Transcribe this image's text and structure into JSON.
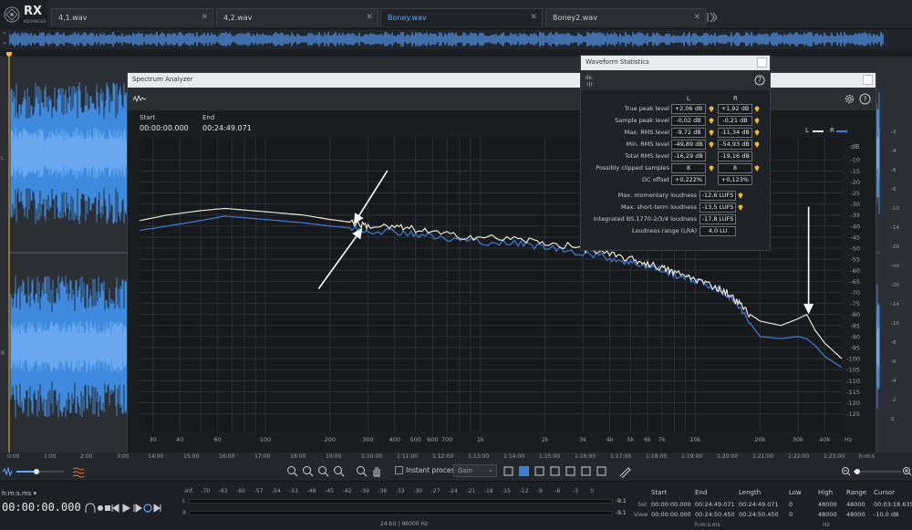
{
  "app": {
    "logo": "RX",
    "logo_sub": "ADVANCED"
  },
  "tabs": [
    {
      "label": "4,1.wav",
      "active": false
    },
    {
      "label": "4,2.wav",
      "active": false
    },
    {
      "label": "Boney.wav",
      "active": true
    },
    {
      "label": "Boney2.wav",
      "active": false
    }
  ],
  "spectrum": {
    "title": "Spectrum Analyzer",
    "start_label": "Start",
    "start_value": "00:00:00.000",
    "end_label": "End",
    "end_value": "00:24:49.071",
    "legend_L": "L",
    "legend_R": "R",
    "db_label": "dB"
  },
  "stats": {
    "title": "Waveform Statistics",
    "col_L": "L",
    "col_R": "R",
    "rows": [
      {
        "name": "True peak level",
        "L": "+2,06 dB",
        "R": "+1,92 dB"
      },
      {
        "name": "Sample peak level",
        "L": "-0,02 dB",
        "R": "-0,21 dB"
      },
      {
        "name": "Max. RMS level",
        "L": "-9,72 dB",
        "R": "-11,34 dB"
      },
      {
        "name": "Min. RMS level",
        "L": "-49,89 dB",
        "R": "-54,93 dB"
      },
      {
        "name": "Total RMS level",
        "L": "-16,29 dB",
        "R": "-19,16 dB"
      },
      {
        "name": "Possibly clipped samples",
        "L": "8",
        "R": "8"
      },
      {
        "name": "DC offset",
        "L": "+0,222%",
        "R": "+0,123%"
      }
    ],
    "loudness": [
      {
        "name": "Max. momentary loudness",
        "value": "-12,6 LUFS"
      },
      {
        "name": "Max. short-term loudness",
        "value": "-13,5 LUFS"
      },
      {
        "name": "Integrated BS.1770-2/3/4 loudness",
        "value": "-17,8 LUFS"
      },
      {
        "name": "Loudness range (LRA)",
        "value": "4,0 LU"
      }
    ]
  },
  "chart_data": {
    "type": "line",
    "title": "",
    "xlabel": "Hz",
    "ylabel": "dB",
    "x_scale": "log",
    "xlim": [
      26,
      48000
    ],
    "ylim": [
      -133,
      0
    ],
    "y_ticks": [
      -10,
      -15,
      -20,
      -25,
      -30,
      -35,
      -40,
      -45,
      -50,
      -55,
      -60,
      -65,
      -70,
      -75,
      -80,
      -85,
      -90,
      -95,
      -100,
      -105,
      -110,
      -115,
      -120,
      -125
    ],
    "x_ticks": [
      {
        "value": 30,
        "label": "30"
      },
      {
        "value": 40,
        "label": "40"
      },
      {
        "value": 60,
        "label": "60"
      },
      {
        "value": 100,
        "label": "100"
      },
      {
        "value": 200,
        "label": "200"
      },
      {
        "value": 300,
        "label": "300"
      },
      {
        "value": 400,
        "label": "400"
      },
      {
        "value": 500,
        "label": "500"
      },
      {
        "value": 600,
        "label": "600"
      },
      {
        "value": 700,
        "label": "700"
      },
      {
        "value": 1000,
        "label": "1k"
      },
      {
        "value": 2000,
        "label": "2k"
      },
      {
        "value": 3000,
        "label": "3k"
      },
      {
        "value": 4000,
        "label": "4k"
      },
      {
        "value": 5000,
        "label": "5k"
      },
      {
        "value": 6000,
        "label": "6k"
      },
      {
        "value": 7000,
        "label": "7k"
      },
      {
        "value": 10000,
        "label": "10k"
      },
      {
        "value": 20000,
        "label": "20k"
      },
      {
        "value": 30000,
        "label": "30k"
      },
      {
        "value": 40000,
        "label": "40k"
      }
    ],
    "grid": true,
    "legend_position": "top-right",
    "series": [
      {
        "name": "L",
        "color": "#e8e8d8",
        "x": [
          26,
          35,
          50,
          65,
          100,
          150,
          200,
          260,
          300,
          400,
          500,
          700,
          1000,
          1500,
          2000,
          3000,
          4000,
          5000,
          6000,
          7000,
          8000,
          10000,
          12000,
          14000,
          16000,
          18000,
          20000,
          25000,
          30000,
          33000,
          36000,
          40000,
          48000
        ],
        "y": [
          -37.5,
          -35,
          -33,
          -32,
          -33.5,
          -35,
          -37,
          -38.5,
          -40,
          -40.5,
          -41.5,
          -44,
          -45,
          -46,
          -47.5,
          -50,
          -53,
          -55,
          -57,
          -59,
          -61,
          -64,
          -67,
          -70,
          -75,
          -80,
          -83,
          -85,
          -82,
          -80,
          -87,
          -93,
          -100
        ]
      },
      {
        "name": "R",
        "color": "#3c7fd8",
        "x": [
          26,
          35,
          50,
          65,
          100,
          150,
          200,
          260,
          300,
          400,
          500,
          700,
          1000,
          1500,
          2000,
          3000,
          4000,
          5000,
          6000,
          7000,
          8000,
          10000,
          12000,
          14000,
          16000,
          18000,
          20000,
          25000,
          30000,
          33000,
          36000,
          40000,
          48000
        ],
        "y": [
          -42,
          -40,
          -37.5,
          -35.5,
          -37,
          -38.5,
          -40,
          -41,
          -42,
          -42.5,
          -43.5,
          -46,
          -47,
          -48,
          -49.5,
          -52,
          -54.5,
          -56.5,
          -58,
          -60,
          -62,
          -64.5,
          -67.5,
          -71,
          -76,
          -84,
          -90,
          -91,
          -90,
          -91,
          -94,
          -99,
          -104
        ]
      }
    ],
    "annotations": [
      {
        "type": "arrow",
        "points_to_hz": 260,
        "points_to_db": -38.5
      },
      {
        "type": "arrow",
        "points_to_hz": 280,
        "points_to_db": -41.5
      },
      {
        "type": "arrow",
        "points_to_hz": 33000,
        "points_to_db": -80
      }
    ]
  },
  "timeline": {
    "ruler": [
      "0:00",
      "1:00",
      "2:00",
      "3:00",
      "14:00",
      "15:00",
      "16:00",
      "17:00",
      "18:00",
      "19:00",
      "1:10:00",
      "1:11:00",
      "1:12:00",
      "1:13:00",
      "1:14:00",
      "1:15:00",
      "1:16:00",
      "1:17:00",
      "1:18:00",
      "1:19:00",
      "1:20:00",
      "1:21:00",
      "1:22:00",
      "1:23:00",
      "h:m:s"
    ],
    "right_scale": [
      "-2",
      "-4",
      "-6",
      "-8",
      "-10",
      "-14",
      "-20",
      "-inf",
      "-20",
      "-14",
      "-10",
      "-8",
      "-6",
      "-4",
      "-2",
      "0"
    ]
  },
  "toolbar": {
    "instant_process": "Instant process",
    "gain": "Gain"
  },
  "transport": {
    "time_format": "h:m:s.ms",
    "time": "00:00:00.000"
  },
  "meters": {
    "scale": [
      "-Inf.",
      "-70",
      "-63",
      "-60",
      "-57",
      "-54",
      "-51",
      "-48",
      "-45",
      "-42",
      "-39",
      "-36",
      "-33",
      "-30",
      "-27",
      "-24",
      "-21",
      "-18",
      "-15",
      "-12",
      "-9",
      "-6",
      "-3",
      "0"
    ],
    "L_label": "L",
    "R_label": "R",
    "L_peak": "-9.1",
    "R_peak": "-9.1",
    "format": "24-bit | 96000 Hz"
  },
  "selection": {
    "headers": {
      "start": "Start",
      "end": "End",
      "length": "Length",
      "low": "Low",
      "high": "High",
      "range": "Range",
      "cursor": "Cursor"
    },
    "sel_label": "Sel",
    "view_label": "View",
    "sel": {
      "start": "00:00:00.000",
      "end": "00:24:49.071",
      "length": "00:24:49.071",
      "low": "0",
      "high": "48000",
      "range": "48000",
      "cursor": "00:03:18.635"
    },
    "view": {
      "start": "00:00:00.000",
      "end": "00:24:50.450",
      "length": "00:24:50.450",
      "low": "0",
      "high": "48000",
      "range": "48000",
      "cursor": "-10,0 dB"
    },
    "time_unit": "h:m:s.ms",
    "freq_unit": "Hz"
  }
}
